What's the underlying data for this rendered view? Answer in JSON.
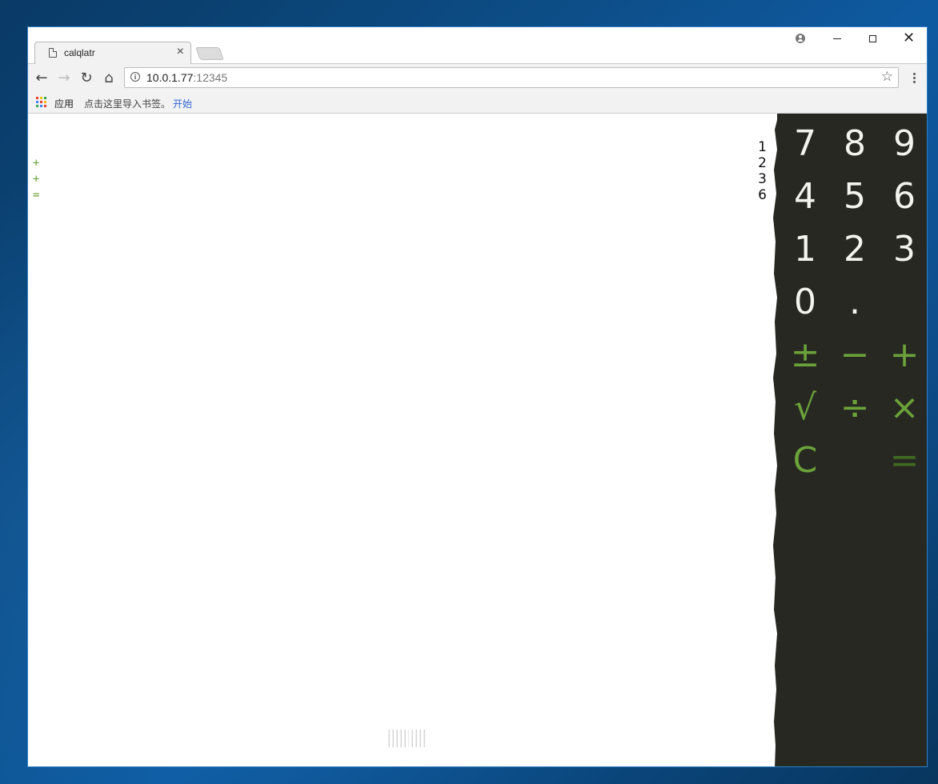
{
  "browser": {
    "tab_title": "calqlatr",
    "tab_close": "×",
    "url_host": "10.0.1.77",
    "url_port": ":12345"
  },
  "bookmarks": {
    "apps_label": "应用",
    "import_text": "点击这里导入书签。",
    "start_link": "开始"
  },
  "tape": {
    "operators": [
      "+",
      "+",
      "="
    ],
    "values": [
      "1",
      "2",
      "3",
      "6"
    ]
  },
  "keypad": {
    "keys": [
      {
        "label": "7",
        "type": "digit"
      },
      {
        "label": "8",
        "type": "digit"
      },
      {
        "label": "9",
        "type": "digit"
      },
      {
        "label": "4",
        "type": "digit"
      },
      {
        "label": "5",
        "type": "digit"
      },
      {
        "label": "6",
        "type": "digit"
      },
      {
        "label": "1",
        "type": "digit"
      },
      {
        "label": "2",
        "type": "digit"
      },
      {
        "label": "3",
        "type": "digit"
      },
      {
        "label": "0",
        "type": "digit"
      },
      {
        "label": ".",
        "type": "digit"
      },
      {
        "label": "",
        "type": "blank"
      },
      {
        "label": "±",
        "type": "op"
      },
      {
        "label": "−",
        "type": "op"
      },
      {
        "label": "+",
        "type": "op"
      },
      {
        "label": "√",
        "type": "op"
      },
      {
        "label": "÷",
        "type": "op"
      },
      {
        "label": "×",
        "type": "op"
      },
      {
        "label": "C",
        "type": "op"
      },
      {
        "label": "",
        "type": "blank"
      },
      {
        "label": "=",
        "type": "faint"
      }
    ]
  },
  "colors": {
    "keypad_bg": "#272822",
    "digit": "#f4f4ef",
    "operator": "#6ba23a",
    "operator_faint": "#3f6a22"
  }
}
